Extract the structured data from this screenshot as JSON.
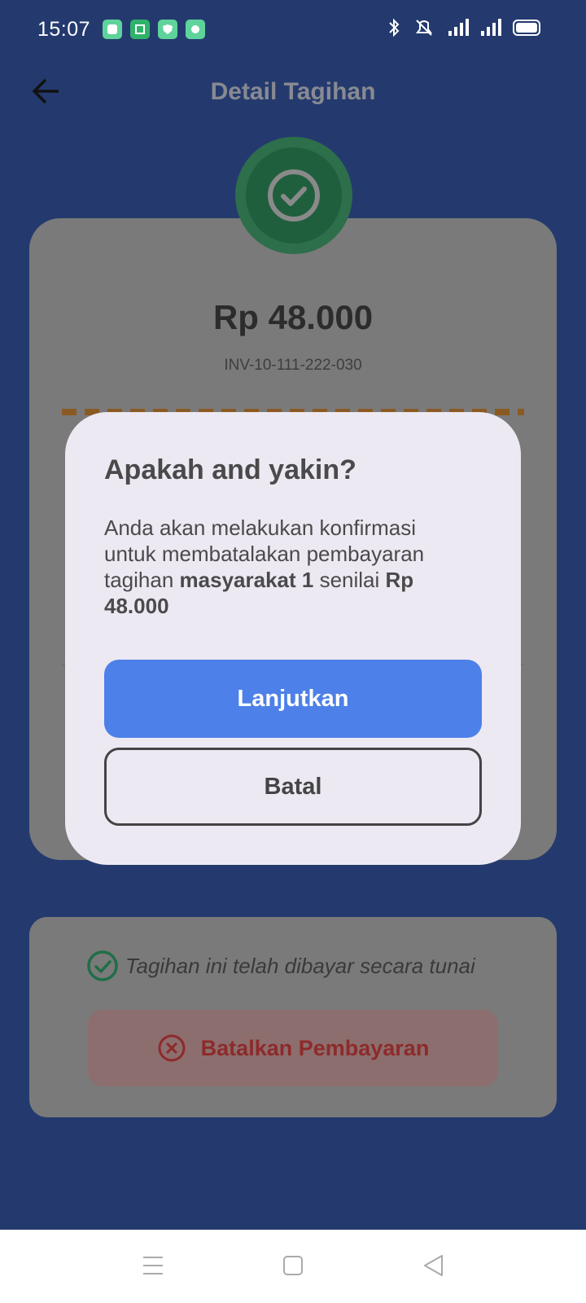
{
  "status_bar": {
    "time": "15:07",
    "icons": [
      "app-icon-1",
      "app-icon-2",
      "shield-app-icon",
      "app-icon-4",
      "bluetooth-icon",
      "mute-icon",
      "signal-icon",
      "signal-icon-2",
      "battery-icon"
    ]
  },
  "header": {
    "title": "Detail Tagihan",
    "back_icon": "arrow-left-icon"
  },
  "bill": {
    "amount": "Rp 48.000",
    "invoice": "INV-10-111-222-030"
  },
  "payment": {
    "status_text": "Tagihan ini telah dibayar secara tunai",
    "cancel_label": "Batalkan Pembayaran"
  },
  "dialog": {
    "title": "Apakah and yakin?",
    "message_part1": "Anda akan melakukan konfirmasi untuk membatalakan pembayaran tagihan ",
    "message_name": "masyarakat 1",
    "message_part2": " senilai ",
    "message_amount": "Rp 48.000",
    "continue_label": "Lanjutkan",
    "cancel_label": "Batal"
  },
  "colors": {
    "background": "#243a6e",
    "primary_button": "#4d80e8",
    "success": "#1f5f3d",
    "danger": "#8e2a2a"
  }
}
